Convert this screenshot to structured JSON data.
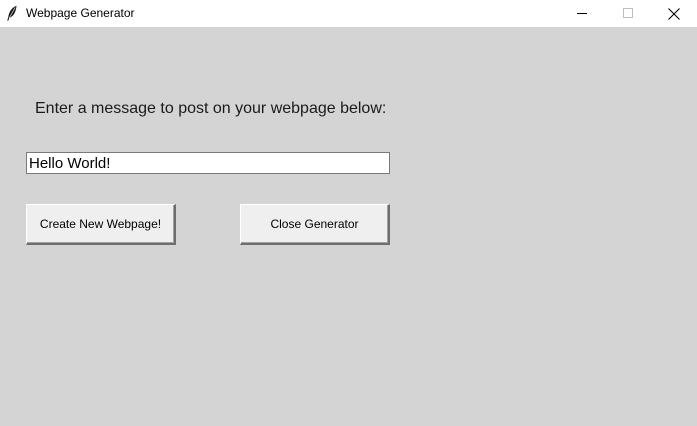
{
  "window": {
    "title": "Webpage Generator",
    "icon": "feather-icon",
    "controls": {
      "minimize": "minimize-icon",
      "maximize": "maximize-icon",
      "close": "close-icon"
    }
  },
  "form": {
    "prompt_label": "Enter a message to post on your webpage below:",
    "message_value": "Hello World!",
    "create_button_label": "Create New Webpage!",
    "close_button_label": "Close Generator"
  },
  "colors": {
    "background": "#d4d4d4",
    "titlebar": "#ffffff",
    "button_face": "#efefef"
  }
}
